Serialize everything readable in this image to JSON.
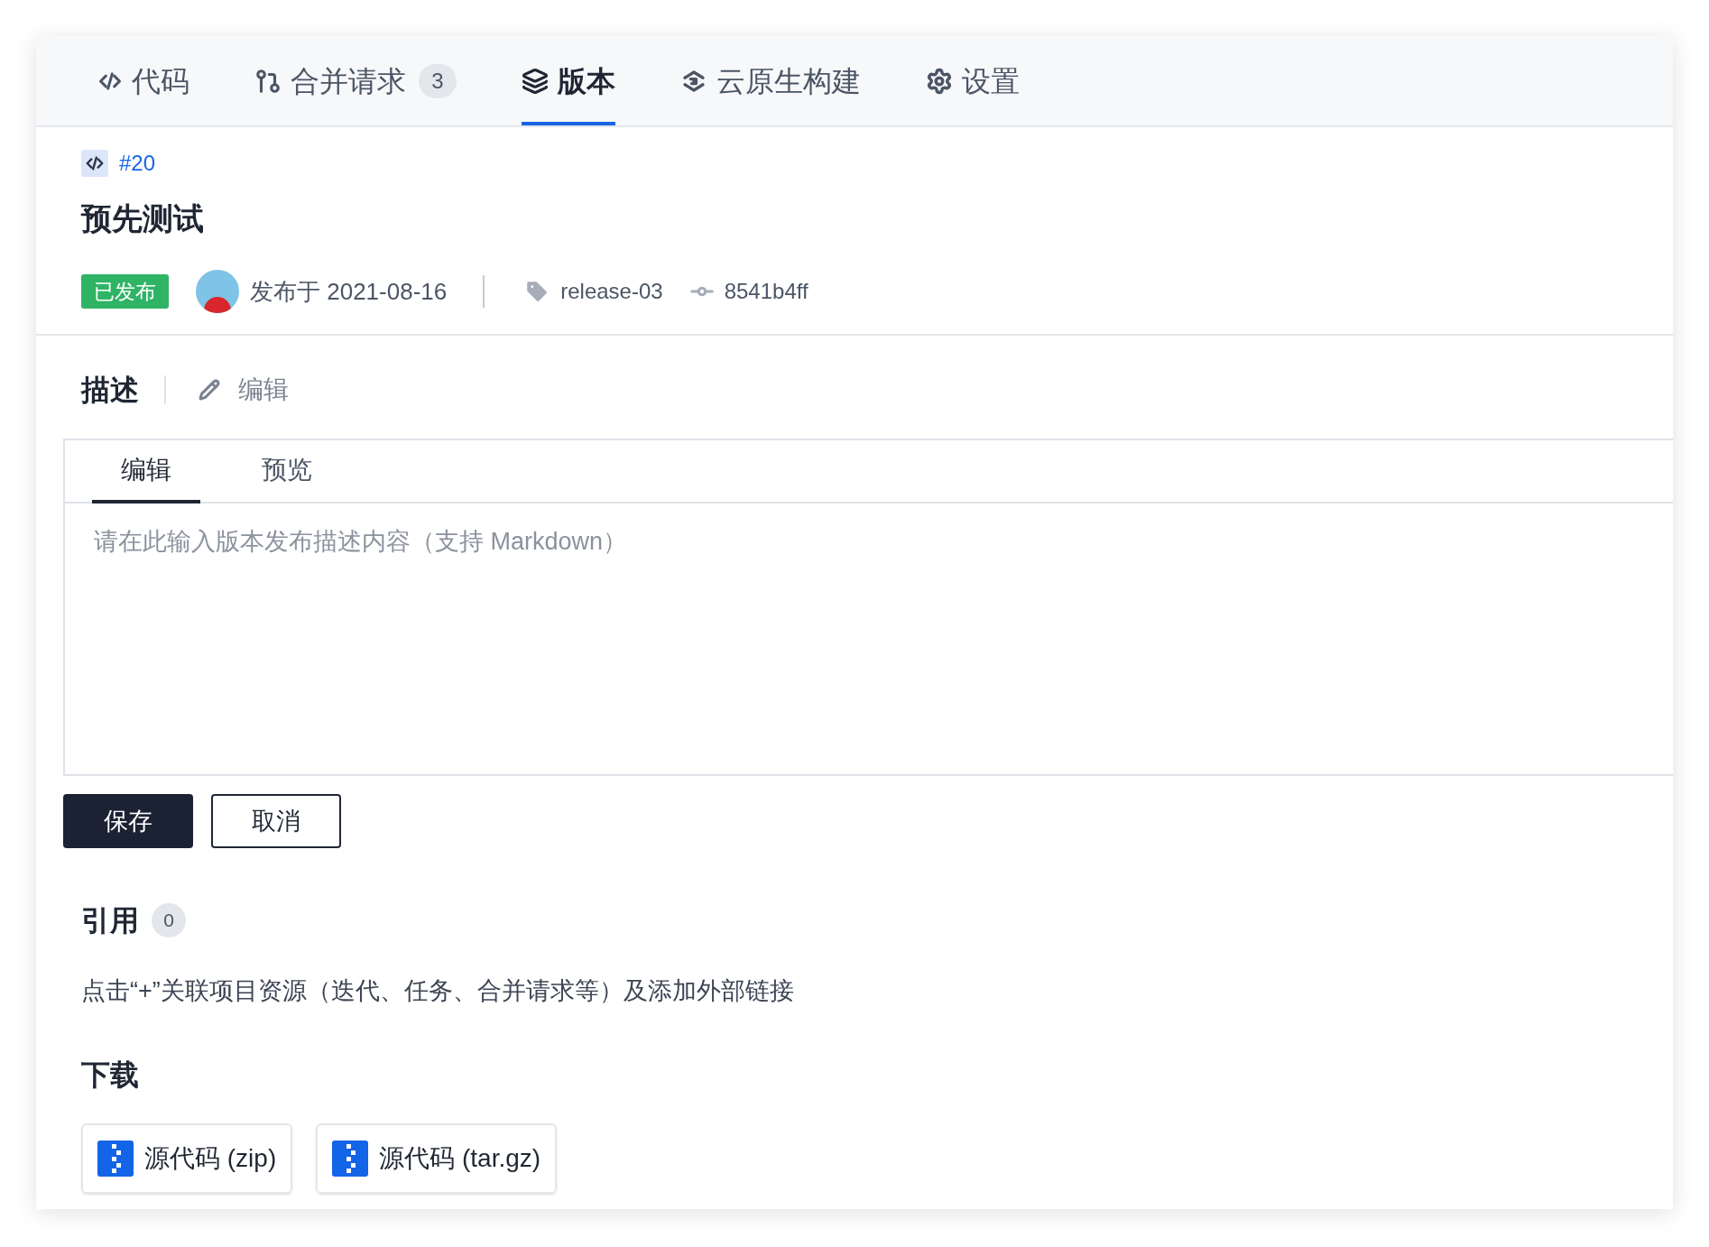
{
  "tabs": [
    {
      "label": "代码",
      "selected": false
    },
    {
      "label": "合并请求",
      "selected": false,
      "badge": "3"
    },
    {
      "label": "版本",
      "selected": true
    },
    {
      "label": "云原生构建",
      "selected": false
    },
    {
      "label": "设置",
      "selected": false
    }
  ],
  "release": {
    "number": "#20",
    "title": "预先测试",
    "status": "已发布",
    "published": "发布于 2021-08-16",
    "tag": "release-03",
    "commit": "8541b4ff"
  },
  "description": {
    "heading": "描述",
    "edit_link": "编辑",
    "editor_tabs": [
      {
        "label": "编辑",
        "selected": true
      },
      {
        "label": "预览",
        "selected": false
      }
    ],
    "placeholder": "请在此输入版本发布描述内容（支持 Markdown）",
    "buttons": [
      "保存",
      "取消"
    ]
  },
  "references": {
    "heading": "引用",
    "count": "0",
    "hint": "点击“+”关联项目资源（迭代、任务、合并请求等）及添加外部链接"
  },
  "downloads": {
    "heading": "下载",
    "files": [
      "源代码 (zip)",
      "源代码 (tar.gz)"
    ]
  }
}
